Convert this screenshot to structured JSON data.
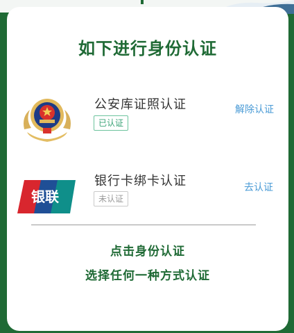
{
  "colors": {
    "brand_green": "#1f6a35",
    "link_blue": "#4a9bd6",
    "badge_green": "#3aa377",
    "badge_gray": "#9a9a9a"
  },
  "page": {
    "title": "如下进行身份认证"
  },
  "methods": [
    {
      "icon": "police-emblem-icon",
      "title": "公安库证照认证",
      "status": "已认证",
      "action": "解除认证"
    },
    {
      "icon": "unionpay-icon",
      "title": "银行卡绑卡认证",
      "status": "未认证",
      "action": "去认证"
    }
  ],
  "unionpay_logo": {
    "text": "银联"
  },
  "footer": {
    "line1": "点击身份认证",
    "line2": "选择任何一种方式认证"
  }
}
